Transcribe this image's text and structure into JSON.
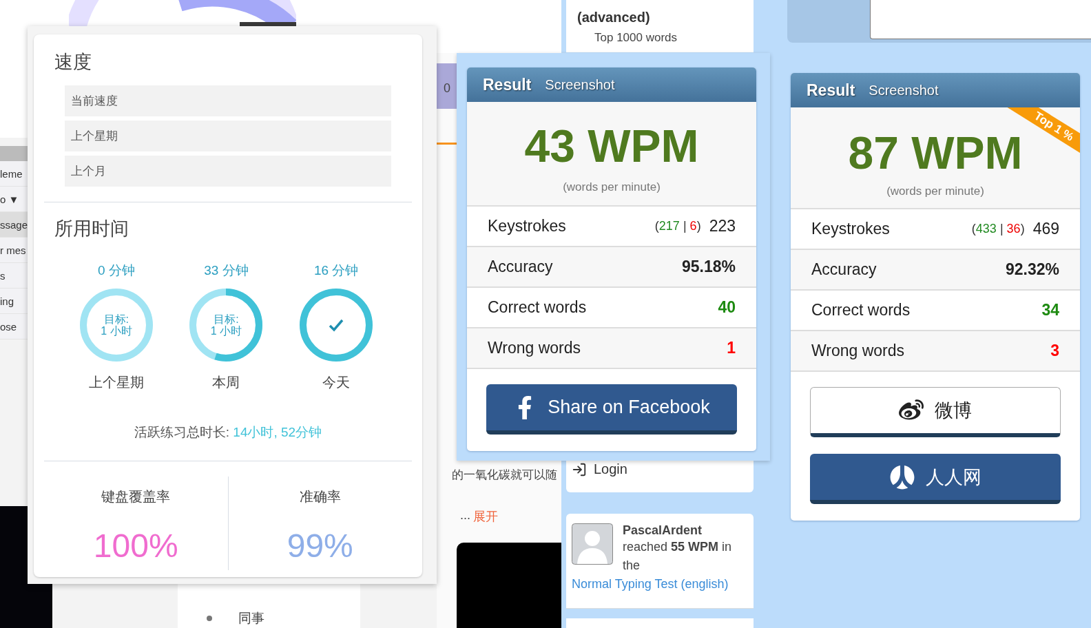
{
  "background": {
    "sidebar_fragments": [
      {
        "text": "leme",
        "selected": false
      },
      {
        "text": "o ▼",
        "selected": false
      },
      {
        "text": "ssage",
        "selected": true
      },
      {
        "text": "r mes",
        "selected": false
      },
      {
        "text": "s",
        "selected": false
      },
      {
        "text": "ing",
        "selected": false
      },
      {
        "text": "ose",
        "selected": false
      }
    ],
    "counter": "0",
    "article": {
      "excerpt": "的一氧化碳就可以随",
      "ellipsis": "...",
      "expand_link": "展开"
    },
    "list_item": "同事",
    "feed": {
      "test_title": "(advanced)",
      "test_subtitle": "Top 1000 words",
      "login": "Login",
      "activity": {
        "user": "PascalArdent",
        "sentence": "reached **55 WPM** in the",
        "link": "Normal Typing Test (english)"
      }
    }
  },
  "goals_panel": {
    "speed_title": "速度",
    "speed_items": [
      "当前速度",
      "上个星期",
      "上个月"
    ],
    "time_title": "所用时间",
    "rings": [
      {
        "minutes": "0 分钟",
        "goal_label": "目标:",
        "goal_value": "1 小时",
        "done": false,
        "caption": "上个星期"
      },
      {
        "minutes": "33 分钟",
        "goal_label": "目标:",
        "goal_value": "1 小时",
        "level": 0.55,
        "done": false,
        "caption": "本周"
      },
      {
        "minutes": "16 分钟",
        "done": true,
        "caption": "今天"
      }
    ],
    "total_label": "活跃练习总时长:",
    "total_value": "14小时, 52分钟",
    "stats": [
      {
        "label": "键盘覆盖率",
        "value": "100%",
        "color": "#f06ccf"
      },
      {
        "label": "准确率",
        "value": "99%",
        "color": "#8eaee8"
      }
    ]
  },
  "results": [
    {
      "title": "Result",
      "tab": "Screenshot",
      "wpm": "43 WPM",
      "unit": "(words per minute)",
      "rows": [
        {
          "kind": "keystrokes",
          "label": "Keystrokes",
          "open": "(",
          "correct": "217",
          "separator": "|",
          "wrong": "6",
          "close": ")",
          "value": "223"
        },
        {
          "kind": "plain",
          "label": "Accuracy",
          "value": "95.18%",
          "color": "#222222"
        },
        {
          "kind": "plain",
          "label": "Correct words",
          "value": "40",
          "color": "#1d8a10"
        },
        {
          "kind": "plain",
          "label": "Wrong words",
          "value": "1",
          "color": "#ff0000"
        }
      ],
      "buttons": [
        {
          "kind": "facebook",
          "label": "Share on Facebook"
        }
      ]
    },
    {
      "title": "Result",
      "tab": "Screenshot",
      "wpm": "87 WPM",
      "unit": "(words per minute)",
      "badge": "Top 1 %",
      "rows": [
        {
          "kind": "keystrokes",
          "label": "Keystrokes",
          "open": "(",
          "correct": "433",
          "separator": "|",
          "wrong": "36",
          "close": ")",
          "value": "469"
        },
        {
          "kind": "plain",
          "label": "Accuracy",
          "value": "92.32%",
          "color": "#222222"
        },
        {
          "kind": "plain",
          "label": "Correct words",
          "value": "34",
          "color": "#1d8a10"
        },
        {
          "kind": "plain",
          "label": "Wrong words",
          "value": "3",
          "color": "#ff0000"
        }
      ],
      "buttons": [
        {
          "kind": "weibo",
          "label": "微博"
        },
        {
          "kind": "renren",
          "label": "人人网"
        }
      ]
    }
  ]
}
